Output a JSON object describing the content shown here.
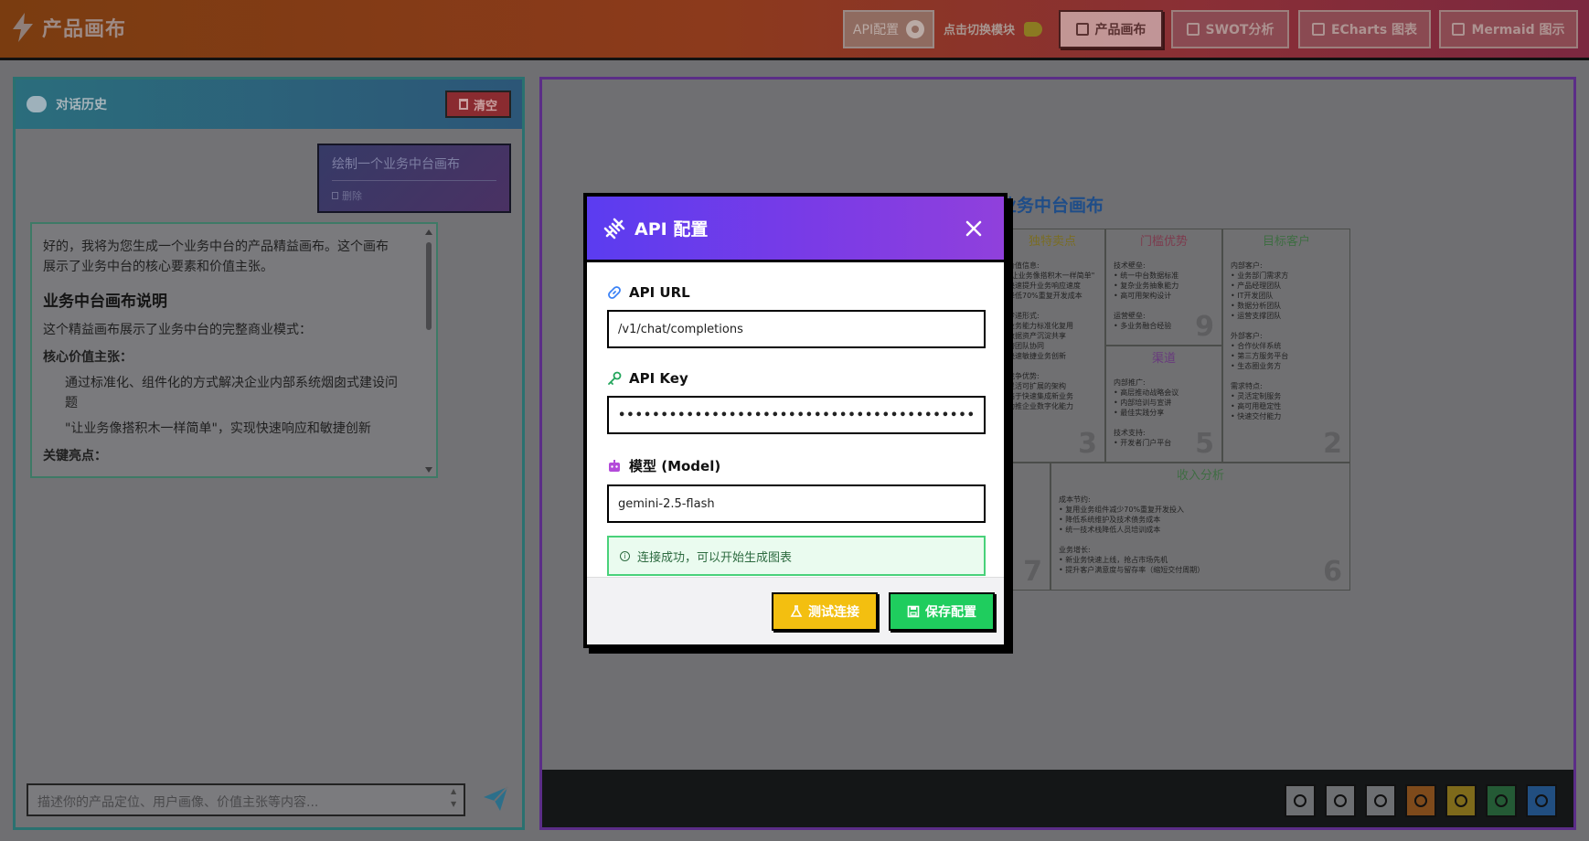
{
  "app": {
    "title": "产品画布"
  },
  "header": {
    "api_config_label": "API配置",
    "switch_tip": "点击切换模块",
    "tabs": [
      {
        "label": "产品画布",
        "active": true
      },
      {
        "label": "SWOT分析",
        "active": false
      },
      {
        "label": "ECharts 图表",
        "active": false
      },
      {
        "label": "Mermaid 图示",
        "active": false
      }
    ]
  },
  "chat": {
    "title": "对话历史",
    "clear_label": "清空",
    "user_message": "绘制一个业务中台画布",
    "user_delete_label": "删除",
    "ai": {
      "intro": "好的，我将为您生成一个业务中台的产品精益画布。这个画布展示了业务中台的核心要素和价值主张。",
      "heading": "业务中台画布说明",
      "desc": "这个精益画布展示了业务中台的完整商业模式：",
      "core_title": "核心价值主张：",
      "core_1": "通过标准化、组件化的方式解决企业内部系统烟囱式建设问题",
      "core_2": "\"让业务像搭积木一样简单\"，实现快速响应和敏捷创新",
      "highlights_title": "关键亮点："
    },
    "input_placeholder": "描述你的产品定位、用户画像、价值主张等内容..."
  },
  "canvas": {
    "title": "业务中台画布",
    "cells": {
      "uvp": {
        "title": "独特卖点",
        "lines": [
          "价值信息:",
          "\"让业务像搭积木一样简单\"",
          "快速提升业务响应速度",
          "降低70%重复开发成本",
          "",
          "传递形式:",
          "业务能力标准化复用",
          "数据资产沉淀共享",
          "跨团队协同",
          "快速敏捷业务创新",
          "",
          "竞争优势:",
          "灵活可扩展的架构",
          "高于快速集成新业务",
          "助推企业数字化能力"
        ],
        "num": "3"
      },
      "advantage": {
        "title": "门槛优势",
        "lines": [
          "技术壁垒:",
          "• 统一中台数据标准",
          "• 复杂业务抽象能力",
          "• 高可用架构设计",
          "",
          "运营壁垒:",
          "• 多业务融合经验"
        ],
        "num": "9"
      },
      "channel": {
        "title": "渠道",
        "lines": [
          "内部推广:",
          "• 高层推动战略会议",
          "• 内部培训与宣讲",
          "• 最佳实践分享",
          "",
          "技术支持:",
          "• 开发者门户平台"
        ],
        "num": "5"
      },
      "customer": {
        "title": "目标客户",
        "lines": [
          "内部客户:",
          "• 业务部门需求方",
          "• 产品经理团队",
          "• IT开发团队",
          "• 数据分析团队",
          "• 运营支撑团队",
          "",
          "外部客户:",
          "• 合作伙伴系统",
          "• 第三方服务平台",
          "• 生态圈业务方",
          "",
          "需求特点:",
          "• 灵活定制服务",
          "• 高可用稳定性",
          "• 快速交付能力"
        ],
        "num": "2"
      },
      "cost_num": "7",
      "revenue": {
        "title": "收入分析",
        "lines": [
          "成本节约:",
          "• 复用业务组件减少70%重复开发投入",
          "• 降低系统维护及技术债务成本",
          "• 统一技术栈降低人员培训成本",
          "",
          "业务增长:",
          "• 新业务快速上线，抢占市场先机",
          "• 提升客户满意度与留存率（缩短交付周期）"
        ],
        "num": "6"
      }
    }
  },
  "modal": {
    "title": "API 配置",
    "url_label": "API URL",
    "url_value": "/v1/chat/completions",
    "key_label": "API Key",
    "key_value": "••••••••••••••••••••••••••••••••••••••••••••••••••••",
    "model_label": "模型 (Model)",
    "model_value": "gemini-2.5-flash",
    "status": "连接成功，可以开始生成图表",
    "test_label": "测试连接",
    "save_label": "保存配置"
  },
  "colors": {
    "accent": "#6b3ceb",
    "success": "#1fcd5e",
    "warning": "#f3bf10"
  }
}
